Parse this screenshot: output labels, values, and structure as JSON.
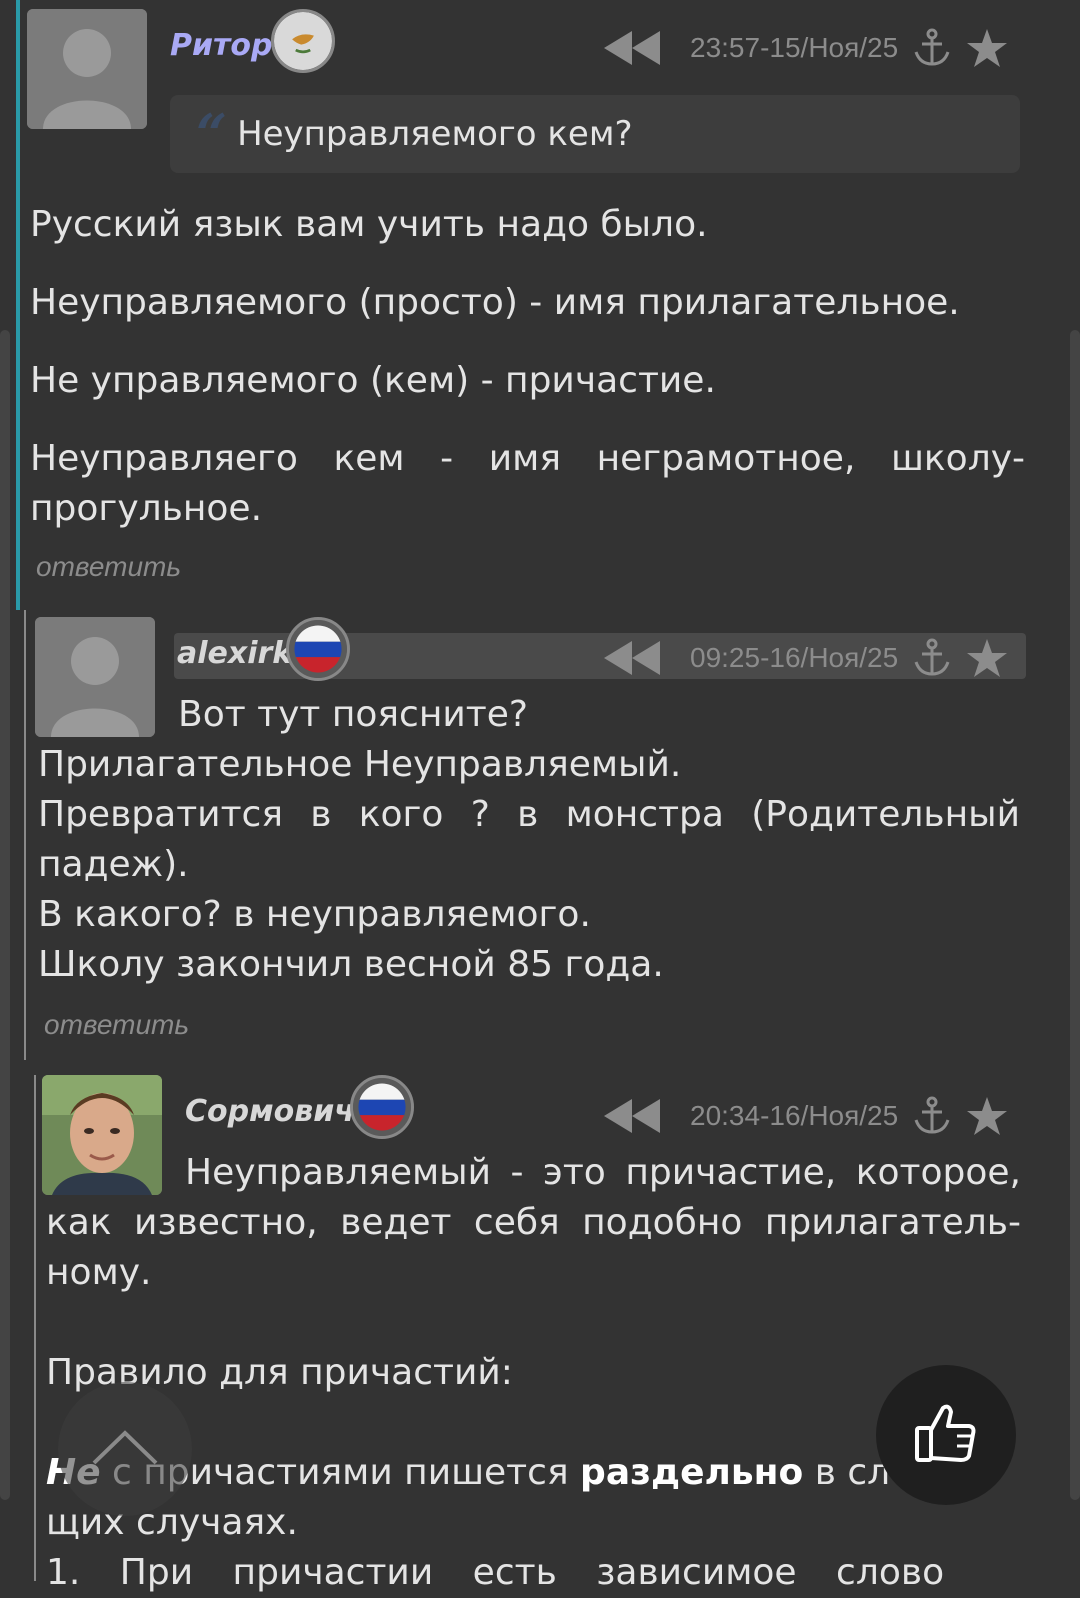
{
  "comments": [
    {
      "author": "Ритор",
      "author_color": "#a9a9f5",
      "flag": "cyprus-flag-icon",
      "time": "23:57-15/Ноя/25",
      "quote": "Неуправляемого кем?",
      "paragraphs": [
        "Русский язык вам учить надо было.",
        "Неуправляемого (просто) - имя прилагательное.",
        "Не управляемого (кем) - причастие.",
        "Неуправляего кем - имя неграмотное, школу-прогульное."
      ],
      "reply_label": "ответить"
    },
    {
      "author": "alexirk",
      "author_color": "#d8d8d8",
      "flag": "russia-flag-icon",
      "time": "09:25-16/Ноя/25",
      "lines": [
        "Вот тут поясните?",
        "Прилагательное Неуправляемый.",
        "Превратится в кого ? в монстра (Родительный падеж).",
        "В какого? в неуправляемого.",
        "Школу закончил весной 85 года."
      ],
      "reply_label": "ответить"
    },
    {
      "author": "Сормович",
      "author_color": "#d8d8d8",
      "flag": "russia-flag-icon",
      "time": "20:34-16/Ноя/25",
      "lines": [
        "Неуправляемый - это причастие, которое, как известно, ведет себя подобно прилагатель-ному.",
        "Правило для причастий:"
      ],
      "rule_prefix": "Не",
      "rule_mid": " с причастиями пишется ",
      "rule_bold": "раздельно",
      "rule_end": " в следую-щих случаях.",
      "rule_cut": "1. При причастии есть зависимое слово"
    }
  ],
  "icons": {
    "rewind": "rewind-icon",
    "anchor": "anchor-icon",
    "star": "star-icon",
    "like": "thumbs-up-icon",
    "scroll_up": "chevron-up-icon"
  }
}
